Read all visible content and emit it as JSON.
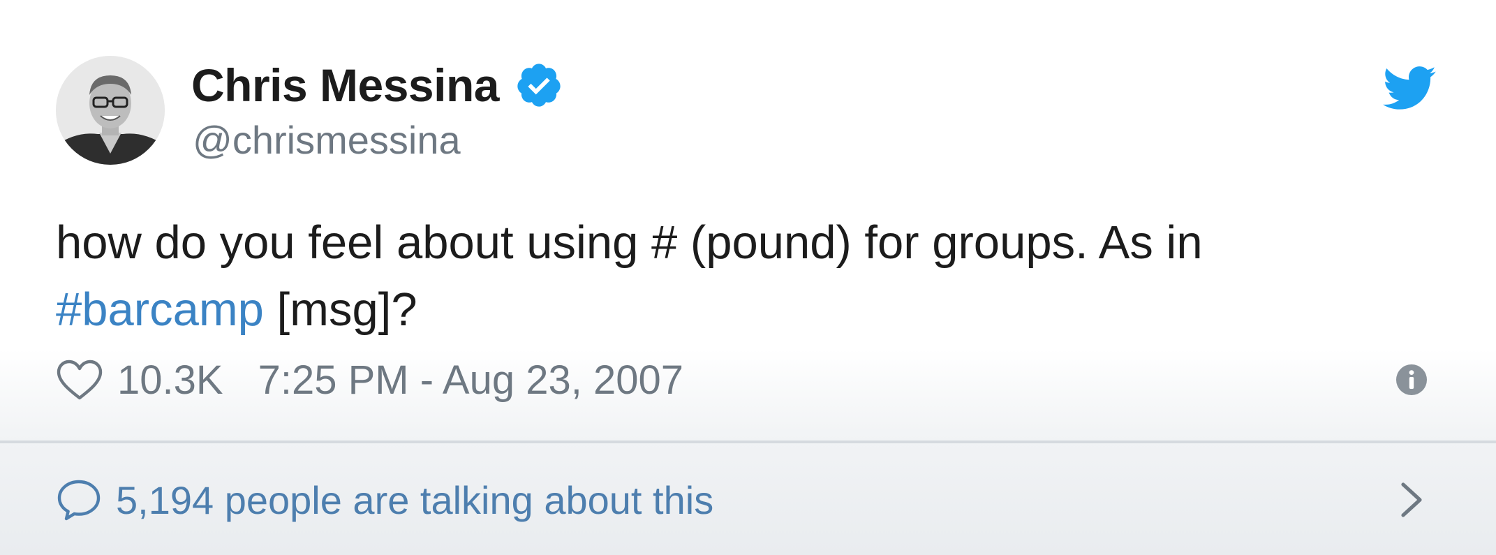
{
  "author": {
    "display_name": "Chris Messina",
    "handle": "@chrismessina",
    "verified": true,
    "avatar_icon": "profile-photo"
  },
  "tweet": {
    "text_before_hashtag": "how do you feel about using # (pound) for groups. As in ",
    "hashtag": "#barcamp",
    "text_after_hashtag": " [msg]?"
  },
  "meta": {
    "like_count": "10.3K",
    "timestamp": "7:25 PM - Aug 23, 2007"
  },
  "conversation": {
    "label": "5,194 people are talking about this"
  },
  "icons": {
    "brand": "twitter-bird-icon",
    "verified": "verified-badge-icon",
    "like": "heart-icon",
    "info": "info-icon",
    "reply": "speech-bubble-icon",
    "chevron": "chevron-right-icon"
  },
  "colors": {
    "brand_blue": "#1da1f2",
    "hashtag_blue": "#3b83c4",
    "link_blue": "#4d7eae",
    "muted_gray": "#6e7882"
  }
}
